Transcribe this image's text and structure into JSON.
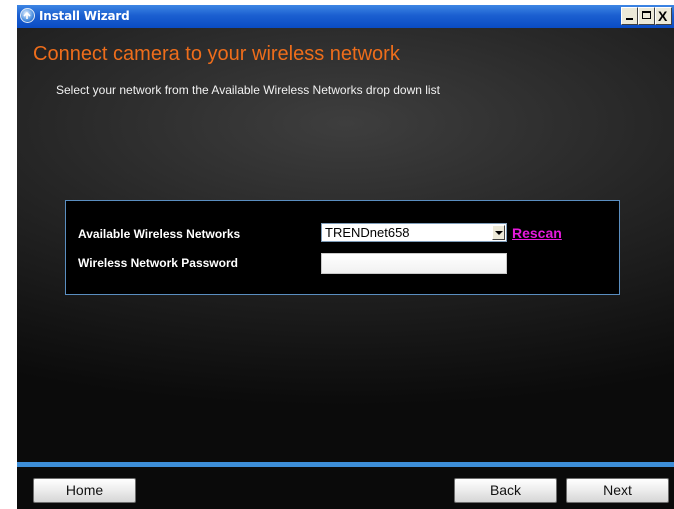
{
  "window": {
    "title": "Install Wizard",
    "controls": {
      "minimize": "_",
      "maximize": "□",
      "close": "X"
    }
  },
  "main": {
    "heading": "Connect camera to your wireless network",
    "subheading": "Select your network from the Available Wireless Networks drop down list"
  },
  "form": {
    "network_label": "Available Wireless Networks",
    "network_selected": "TRENDnet658",
    "rescan_label": "Rescan",
    "password_label": "Wireless Network Password",
    "password_value": ""
  },
  "footer": {
    "home_label": "Home",
    "back_label": "Back",
    "next_label": "Next"
  },
  "colors": {
    "heading": "#ee6d1b",
    "rescan_link": "#e61adc",
    "panel_border": "#5a8ec0",
    "footer_accent": "#3d8ed8",
    "titlebar": "#1b5fd0"
  },
  "icons": {
    "app": "install-wizard-icon",
    "dropdown": "chevron-down-icon"
  }
}
